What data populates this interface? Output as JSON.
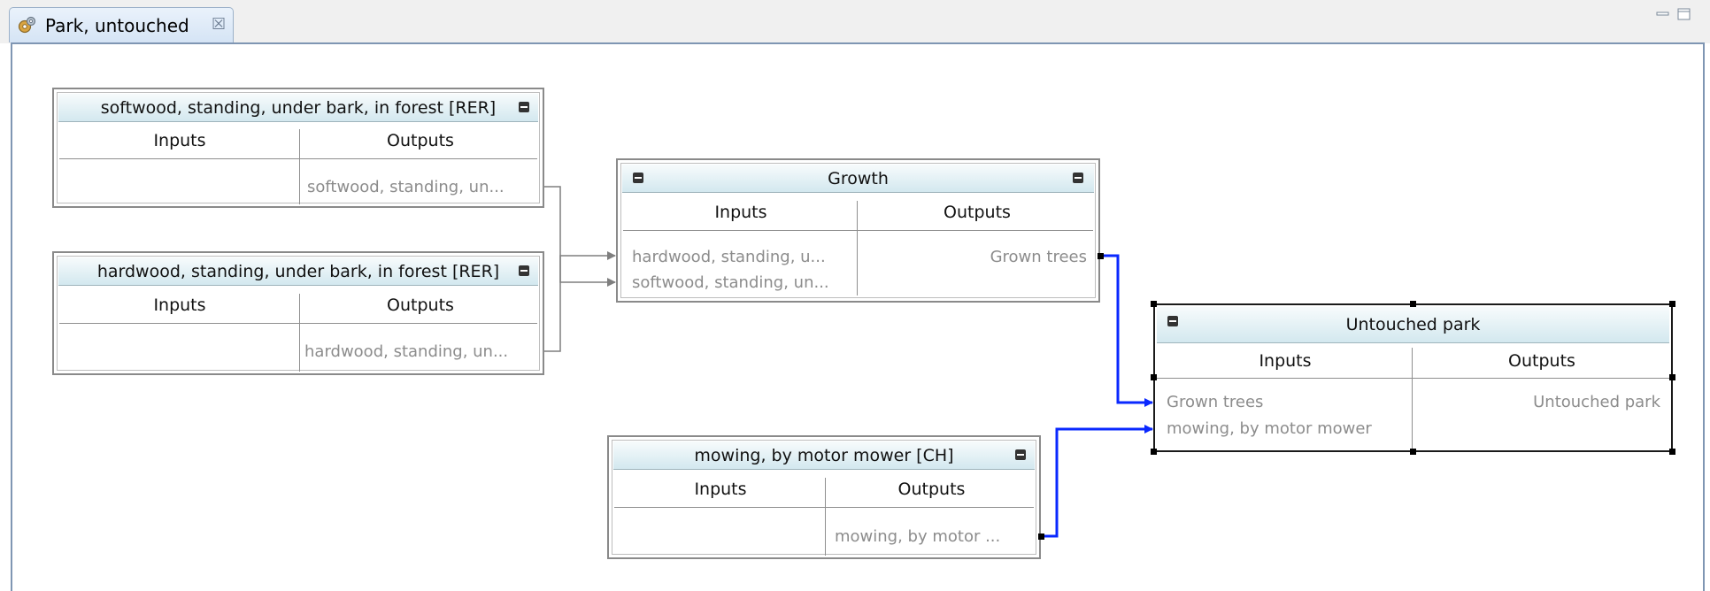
{
  "tab": {
    "title": "Park, untouched",
    "close_glyph": "☒",
    "icon": "gear-icon"
  },
  "window_controls": {
    "minimize": "minimize-icon",
    "maximize": "maximize-icon"
  },
  "columns": {
    "inputs": "Inputs",
    "outputs": "Outputs"
  },
  "nodes": {
    "softwood": {
      "title": "softwood, standing, under bark, in forest [RER]",
      "outputs": [
        "softwood, standing, un..."
      ]
    },
    "hardwood": {
      "title": "hardwood, standing, under bark, in forest [RER]",
      "outputs": [
        "hardwood, standing, un..."
      ]
    },
    "growth": {
      "title": "Growth",
      "inputs": [
        "hardwood, standing, u...",
        "softwood, standing, un..."
      ],
      "outputs": [
        "Grown trees"
      ]
    },
    "mowing": {
      "title": "mowing, by motor mower [CH]",
      "outputs": [
        "mowing, by motor ..."
      ]
    },
    "park": {
      "title": "Untouched park",
      "inputs": [
        "Grown trees",
        "mowing, by motor mower"
      ],
      "outputs": [
        "Untouched park"
      ]
    }
  },
  "colors": {
    "selected_link": "#0a28ff",
    "link": "#7f7f7f",
    "header_grad_top": "#f7fbfc",
    "header_grad_bottom": "#d3e8ef"
  }
}
